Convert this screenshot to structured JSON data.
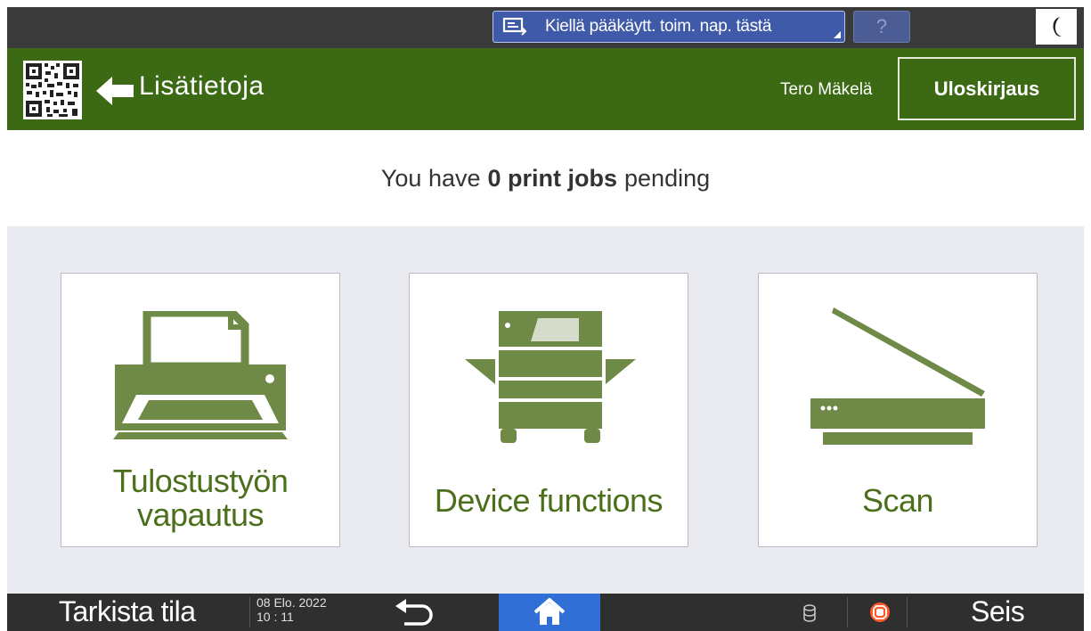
{
  "system_bar": {
    "admin_button_label": "Kiellä pääkäytt. toim. nap. tästä",
    "help_label": "?",
    "icons": [
      "screen-admin-icon",
      "moon-icon"
    ]
  },
  "header": {
    "title": "Lisätietoja",
    "username": "Tero Mäkelä",
    "logout_label": "Uloskirjaus",
    "colors": {
      "header_bg": "#3c6a14",
      "accent": "#4c6f1c"
    }
  },
  "pending": {
    "prefix": "You have",
    "count_text": "0 print jobs",
    "suffix": "pending"
  },
  "tiles": [
    {
      "label_line1": "Tulostustyön",
      "label_line2": "vapautus",
      "icon": "printer-icon"
    },
    {
      "label": "Device functions",
      "icon": "copier-icon"
    },
    {
      "label": "Scan",
      "icon": "scanner-icon"
    }
  ],
  "bottom_bar": {
    "status_label": "Tarkista tila",
    "date": "08 Elo. 2022",
    "time": "10 : 11",
    "stop_label": "Seis",
    "colors": {
      "home_bg": "#2f6fd6",
      "stop_color": "#ff5a2a"
    }
  }
}
